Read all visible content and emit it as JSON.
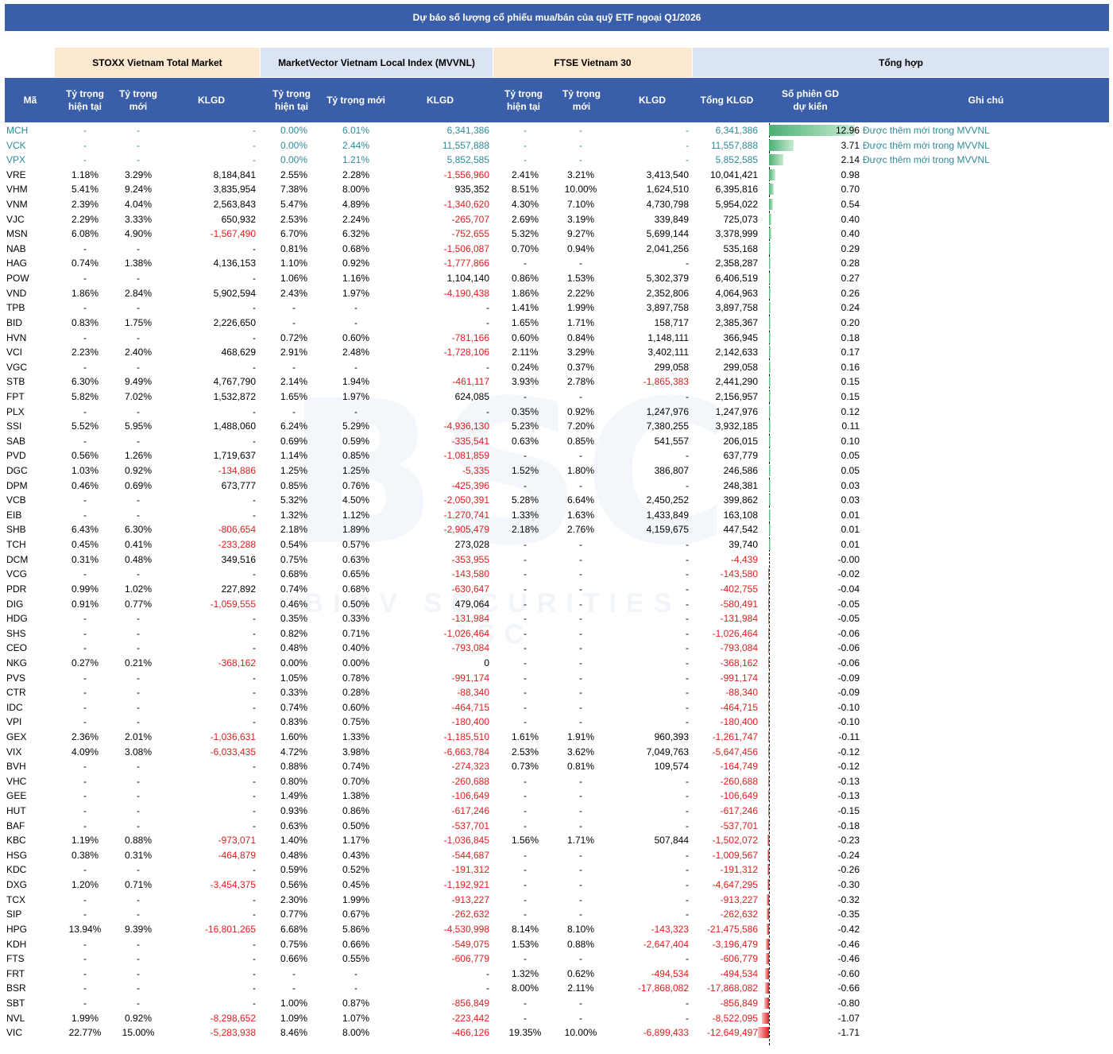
{
  "title": "Dự báo số lượng cổ phiếu mua/bán của quỹ ETF ngoại Q1/2026",
  "groups": {
    "stoxx": "STOXX Vietnam Total Market",
    "mvvnl": "MarketVector Vietnam Local Index (MVVNL)",
    "ftse": "FTSE Vietnam 30",
    "total": "Tổng hợp"
  },
  "headers": {
    "ma": "Mã",
    "stoxx_cur": "Tỷ trọng hiện tại",
    "stoxx_new": "Tỷ trọng mới",
    "stoxx_klgd": "KLGD",
    "mv_cur": "Tỷ trọng hiện tại",
    "mv_new": "Tỷ trọng mới",
    "mv_klgd": "KLGD",
    "ftse_cur": "Tỷ trọng hiện tại",
    "ftse_new": "Tỷ trọng mới",
    "ftse_klgd": "KLGD",
    "tong": "Tổng KLGD",
    "sessions": "Số phiên GD dự kiến",
    "note": "Ghi chú"
  },
  "colors": {
    "header_bg": "#3a5fa8",
    "stoxx_bg": "#fde9d0",
    "mvvnl_bg": "#dbe4f3",
    "ftse_bg": "#fde9d0",
    "total_bg": "#dbe4f3",
    "negative": "#e0201e",
    "new_stock": "#2e8b9a",
    "bar_pos": "#4caf73",
    "bar_neg": "#e02020"
  },
  "watermark": {
    "logo_text": "BSC",
    "sub_text": "BIDV SECURITIES JSC"
  },
  "rows": [
    [
      "MCH",
      "-",
      "-",
      "-",
      "0.00%",
      "6.01%",
      "6,341,386",
      "-",
      "-",
      "-",
      "6,341,386",
      "12.96",
      "Được thêm mới trong MVVNL"
    ],
    [
      "VCK",
      "-",
      "-",
      "-",
      "0.00%",
      "2.44%",
      "11,557,888",
      "-",
      "-",
      "-",
      "11,557,888",
      "3.71",
      "Được thêm mới trong MVVNL"
    ],
    [
      "VPX",
      "-",
      "-",
      "-",
      "0.00%",
      "1.21%",
      "5,852,585",
      "-",
      "-",
      "-",
      "5,852,585",
      "2.14",
      "Được thêm mới trong MVVNL"
    ],
    [
      "VRE",
      "1.18%",
      "3.29%",
      "8,184,841",
      "2.55%",
      "2.28%",
      "-1,556,960",
      "2.41%",
      "3.21%",
      "3,413,540",
      "10,041,421",
      "0.98",
      ""
    ],
    [
      "VHM",
      "5.41%",
      "9.24%",
      "3,835,954",
      "7.38%",
      "8.00%",
      "935,352",
      "8.51%",
      "10.00%",
      "1,624,510",
      "6,395,816",
      "0.70",
      ""
    ],
    [
      "VNM",
      "2.39%",
      "4.04%",
      "2,563,843",
      "5.47%",
      "4.89%",
      "-1,340,620",
      "4.30%",
      "7.10%",
      "4,730,798",
      "5,954,022",
      "0.54",
      ""
    ],
    [
      "VJC",
      "2.29%",
      "3.33%",
      "650,932",
      "2.53%",
      "2.24%",
      "-265,707",
      "2.69%",
      "3.19%",
      "339,849",
      "725,073",
      "0.40",
      ""
    ],
    [
      "MSN",
      "6.08%",
      "4.90%",
      "-1,567,490",
      "6.70%",
      "6.32%",
      "-752,655",
      "5.32%",
      "9.27%",
      "5,699,144",
      "3,378,999",
      "0.40",
      ""
    ],
    [
      "NAB",
      "-",
      "-",
      "-",
      "0.81%",
      "0.68%",
      "-1,506,087",
      "0.70%",
      "0.94%",
      "2,041,256",
      "535,168",
      "0.29",
      ""
    ],
    [
      "HAG",
      "0.74%",
      "1.38%",
      "4,136,153",
      "1.10%",
      "0.92%",
      "-1,777,866",
      "-",
      "-",
      "-",
      "2,358,287",
      "0.28",
      ""
    ],
    [
      "POW",
      "-",
      "-",
      "-",
      "1.06%",
      "1.16%",
      "1,104,140",
      "0.86%",
      "1.53%",
      "5,302,379",
      "6,406,519",
      "0.27",
      ""
    ],
    [
      "VND",
      "1.86%",
      "2.84%",
      "5,902,594",
      "2.43%",
      "1.97%",
      "-4,190,438",
      "1.86%",
      "2.22%",
      "2,352,806",
      "4,064,963",
      "0.26",
      ""
    ],
    [
      "TPB",
      "-",
      "-",
      "-",
      "-",
      "-",
      "-",
      "1.41%",
      "1.99%",
      "3,897,758",
      "3,897,758",
      "0.24",
      ""
    ],
    [
      "BID",
      "0.83%",
      "1.75%",
      "2,226,650",
      "-",
      "-",
      "-",
      "1.65%",
      "1.71%",
      "158,717",
      "2,385,367",
      "0.20",
      ""
    ],
    [
      "HVN",
      "-",
      "-",
      "-",
      "0.72%",
      "0.60%",
      "-781,166",
      "0.60%",
      "0.84%",
      "1,148,111",
      "366,945",
      "0.18",
      ""
    ],
    [
      "VCI",
      "2.23%",
      "2.40%",
      "468,629",
      "2.91%",
      "2.48%",
      "-1,728,106",
      "2.11%",
      "3.29%",
      "3,402,111",
      "2,142,633",
      "0.17",
      ""
    ],
    [
      "VGC",
      "-",
      "-",
      "-",
      "-",
      "-",
      "-",
      "0.24%",
      "0.37%",
      "299,058",
      "299,058",
      "0.16",
      ""
    ],
    [
      "STB",
      "6.30%",
      "9.49%",
      "4,767,790",
      "2.14%",
      "1.94%",
      "-461,117",
      "3.93%",
      "2.78%",
      "-1,865,383",
      "2,441,290",
      "0.15",
      ""
    ],
    [
      "FPT",
      "5.82%",
      "7.02%",
      "1,532,872",
      "1.65%",
      "1.97%",
      "624,085",
      "-",
      "-",
      "-",
      "2,156,957",
      "0.15",
      ""
    ],
    [
      "PLX",
      "-",
      "-",
      "-",
      "-",
      "-",
      "-",
      "0.35%",
      "0.92%",
      "1,247,976",
      "1,247,976",
      "0.12",
      ""
    ],
    [
      "SSI",
      "5.52%",
      "5.95%",
      "1,488,060",
      "6.24%",
      "5.29%",
      "-4,936,130",
      "5.23%",
      "7.20%",
      "7,380,255",
      "3,932,185",
      "0.11",
      ""
    ],
    [
      "SAB",
      "-",
      "-",
      "-",
      "0.69%",
      "0.59%",
      "-335,541",
      "0.63%",
      "0.85%",
      "541,557",
      "206,015",
      "0.10",
      ""
    ],
    [
      "PVD",
      "0.56%",
      "1.26%",
      "1,719,637",
      "1.14%",
      "0.85%",
      "-1,081,859",
      "-",
      "-",
      "-",
      "637,779",
      "0.05",
      ""
    ],
    [
      "DGC",
      "1.03%",
      "0.92%",
      "-134,886",
      "1.25%",
      "1.25%",
      "-5,335",
      "1.52%",
      "1.80%",
      "386,807",
      "246,586",
      "0.05",
      ""
    ],
    [
      "DPM",
      "0.46%",
      "0.69%",
      "673,777",
      "0.85%",
      "0.76%",
      "-425,396",
      "-",
      "-",
      "-",
      "248,381",
      "0.03",
      ""
    ],
    [
      "VCB",
      "-",
      "-",
      "-",
      "5.32%",
      "4.50%",
      "-2,050,391",
      "5.28%",
      "6.64%",
      "2,450,252",
      "399,862",
      "0.03",
      ""
    ],
    [
      "EIB",
      "-",
      "-",
      "-",
      "1.32%",
      "1.12%",
      "-1,270,741",
      "1.33%",
      "1.63%",
      "1,433,849",
      "163,108",
      "0.01",
      ""
    ],
    [
      "SHB",
      "6.43%",
      "6.30%",
      "-806,654",
      "2.18%",
      "1.89%",
      "-2,905,479",
      "2.18%",
      "2.76%",
      "4,159,675",
      "447,542",
      "0.01",
      ""
    ],
    [
      "TCH",
      "0.45%",
      "0.41%",
      "-233,288",
      "0.54%",
      "0.57%",
      "273,028",
      "-",
      "-",
      "-",
      "39,740",
      "0.01",
      ""
    ],
    [
      "DCM",
      "0.31%",
      "0.48%",
      "349,516",
      "0.75%",
      "0.63%",
      "-353,955",
      "-",
      "-",
      "-",
      "-4,439",
      "-0.00",
      ""
    ],
    [
      "VCG",
      "-",
      "-",
      "-",
      "0.68%",
      "0.65%",
      "-143,580",
      "-",
      "-",
      "-",
      "-143,580",
      "-0.02",
      ""
    ],
    [
      "PDR",
      "0.99%",
      "1.02%",
      "227,892",
      "0.74%",
      "0.68%",
      "-630,647",
      "-",
      "-",
      "-",
      "-402,755",
      "-0.04",
      ""
    ],
    [
      "DIG",
      "0.91%",
      "0.77%",
      "-1,059,555",
      "0.46%",
      "0.50%",
      "479,064",
      "-",
      "-",
      "-",
      "-580,491",
      "-0.05",
      ""
    ],
    [
      "HDG",
      "-",
      "-",
      "-",
      "0.35%",
      "0.33%",
      "-131,984",
      "-",
      "-",
      "-",
      "-131,984",
      "-0.05",
      ""
    ],
    [
      "SHS",
      "-",
      "-",
      "-",
      "0.82%",
      "0.71%",
      "-1,026,464",
      "-",
      "-",
      "-",
      "-1,026,464",
      "-0.06",
      ""
    ],
    [
      "CEO",
      "-",
      "-",
      "-",
      "0.48%",
      "0.40%",
      "-793,084",
      "-",
      "-",
      "-",
      "-793,084",
      "-0.06",
      ""
    ],
    [
      "NKG",
      "0.27%",
      "0.21%",
      "-368,162",
      "0.00%",
      "0.00%",
      "0",
      "-",
      "-",
      "-",
      "-368,162",
      "-0.06",
      ""
    ],
    [
      "PVS",
      "-",
      "-",
      "-",
      "1.05%",
      "0.78%",
      "-991,174",
      "-",
      "-",
      "-",
      "-991,174",
      "-0.09",
      ""
    ],
    [
      "CTR",
      "-",
      "-",
      "-",
      "0.33%",
      "0.28%",
      "-88,340",
      "-",
      "-",
      "-",
      "-88,340",
      "-0.09",
      ""
    ],
    [
      "IDC",
      "-",
      "-",
      "-",
      "0.74%",
      "0.60%",
      "-464,715",
      "-",
      "-",
      "-",
      "-464,715",
      "-0.10",
      ""
    ],
    [
      "VPI",
      "-",
      "-",
      "-",
      "0.83%",
      "0.75%",
      "-180,400",
      "-",
      "-",
      "-",
      "-180,400",
      "-0.10",
      ""
    ],
    [
      "GEX",
      "2.36%",
      "2.01%",
      "-1,036,631",
      "1.60%",
      "1.33%",
      "-1,185,510",
      "1.61%",
      "1.91%",
      "960,393",
      "-1,261,747",
      "-0.11",
      ""
    ],
    [
      "VIX",
      "4.09%",
      "3.08%",
      "-6,033,435",
      "4.72%",
      "3.98%",
      "-6,663,784",
      "2.53%",
      "3.62%",
      "7,049,763",
      "-5,647,456",
      "-0.12",
      ""
    ],
    [
      "BVH",
      "-",
      "-",
      "-",
      "0.88%",
      "0.74%",
      "-274,323",
      "0.73%",
      "0.81%",
      "109,574",
      "-164,749",
      "-0.12",
      ""
    ],
    [
      "VHC",
      "-",
      "-",
      "-",
      "0.80%",
      "0.70%",
      "-260,688",
      "-",
      "-",
      "-",
      "-260,688",
      "-0.13",
      ""
    ],
    [
      "GEE",
      "-",
      "-",
      "-",
      "1.49%",
      "1.38%",
      "-106,649",
      "-",
      "-",
      "-",
      "-106,649",
      "-0.13",
      ""
    ],
    [
      "HUT",
      "-",
      "-",
      "-",
      "0.93%",
      "0.86%",
      "-617,246",
      "-",
      "-",
      "-",
      "-617,246",
      "-0.15",
      ""
    ],
    [
      "BAF",
      "-",
      "-",
      "-",
      "0.63%",
      "0.50%",
      "-537,701",
      "-",
      "-",
      "-",
      "-537,701",
      "-0.18",
      ""
    ],
    [
      "KBC",
      "1.19%",
      "0.88%",
      "-973,071",
      "1.40%",
      "1.17%",
      "-1,036,845",
      "1.56%",
      "1.71%",
      "507,844",
      "-1,502,072",
      "-0.23",
      ""
    ],
    [
      "HSG",
      "0.38%",
      "0.31%",
      "-464,879",
      "0.48%",
      "0.43%",
      "-544,687",
      "-",
      "-",
      "-",
      "-1,009,567",
      "-0.24",
      ""
    ],
    [
      "KDC",
      "-",
      "-",
      "-",
      "0.59%",
      "0.52%",
      "-191,312",
      "-",
      "-",
      "-",
      "-191,312",
      "-0.26",
      ""
    ],
    [
      "DXG",
      "1.20%",
      "0.71%",
      "-3,454,375",
      "0.56%",
      "0.45%",
      "-1,192,921",
      "-",
      "-",
      "-",
      "-4,647,295",
      "-0.30",
      ""
    ],
    [
      "TCX",
      "-",
      "-",
      "-",
      "2.30%",
      "1.99%",
      "-913,227",
      "-",
      "-",
      "-",
      "-913,227",
      "-0.32",
      ""
    ],
    [
      "SIP",
      "-",
      "-",
      "-",
      "0.77%",
      "0.67%",
      "-262,632",
      "-",
      "-",
      "-",
      "-262,632",
      "-0.35",
      ""
    ],
    [
      "HPG",
      "13.94%",
      "9.39%",
      "-16,801,265",
      "6.68%",
      "5.86%",
      "-4,530,998",
      "8.14%",
      "8.10%",
      "-143,323",
      "-21,475,586",
      "-0.42",
      ""
    ],
    [
      "KDH",
      "-",
      "-",
      "-",
      "0.75%",
      "0.66%",
      "-549,075",
      "1.53%",
      "0.88%",
      "-2,647,404",
      "-3,196,479",
      "-0.46",
      ""
    ],
    [
      "FTS",
      "-",
      "-",
      "-",
      "0.66%",
      "0.55%",
      "-606,779",
      "-",
      "-",
      "-",
      "-606,779",
      "-0.46",
      ""
    ],
    [
      "FRT",
      "-",
      "-",
      "-",
      "-",
      "-",
      "-",
      "1.32%",
      "0.62%",
      "-494,534",
      "-494,534",
      "-0.60",
      ""
    ],
    [
      "BSR",
      "-",
      "-",
      "-",
      "-",
      "-",
      "-",
      "8.00%",
      "2.11%",
      "-17,868,082",
      "-17,868,082",
      "-0.66",
      ""
    ],
    [
      "SBT",
      "-",
      "-",
      "-",
      "1.00%",
      "0.87%",
      "-856,849",
      "-",
      "-",
      "-",
      "-856,849",
      "-0.80",
      ""
    ],
    [
      "NVL",
      "1.99%",
      "0.92%",
      "-8,298,652",
      "1.09%",
      "1.07%",
      "-223,442",
      "-",
      "-",
      "-",
      "-8,522,095",
      "-1.07",
      ""
    ],
    [
      "VIC",
      "22.77%",
      "15.00%",
      "-5,283,938",
      "8.46%",
      "8.00%",
      "-466,126",
      "19.35%",
      "10.00%",
      "-6,899,433",
      "-12,649,497",
      "-1.71",
      ""
    ]
  ]
}
